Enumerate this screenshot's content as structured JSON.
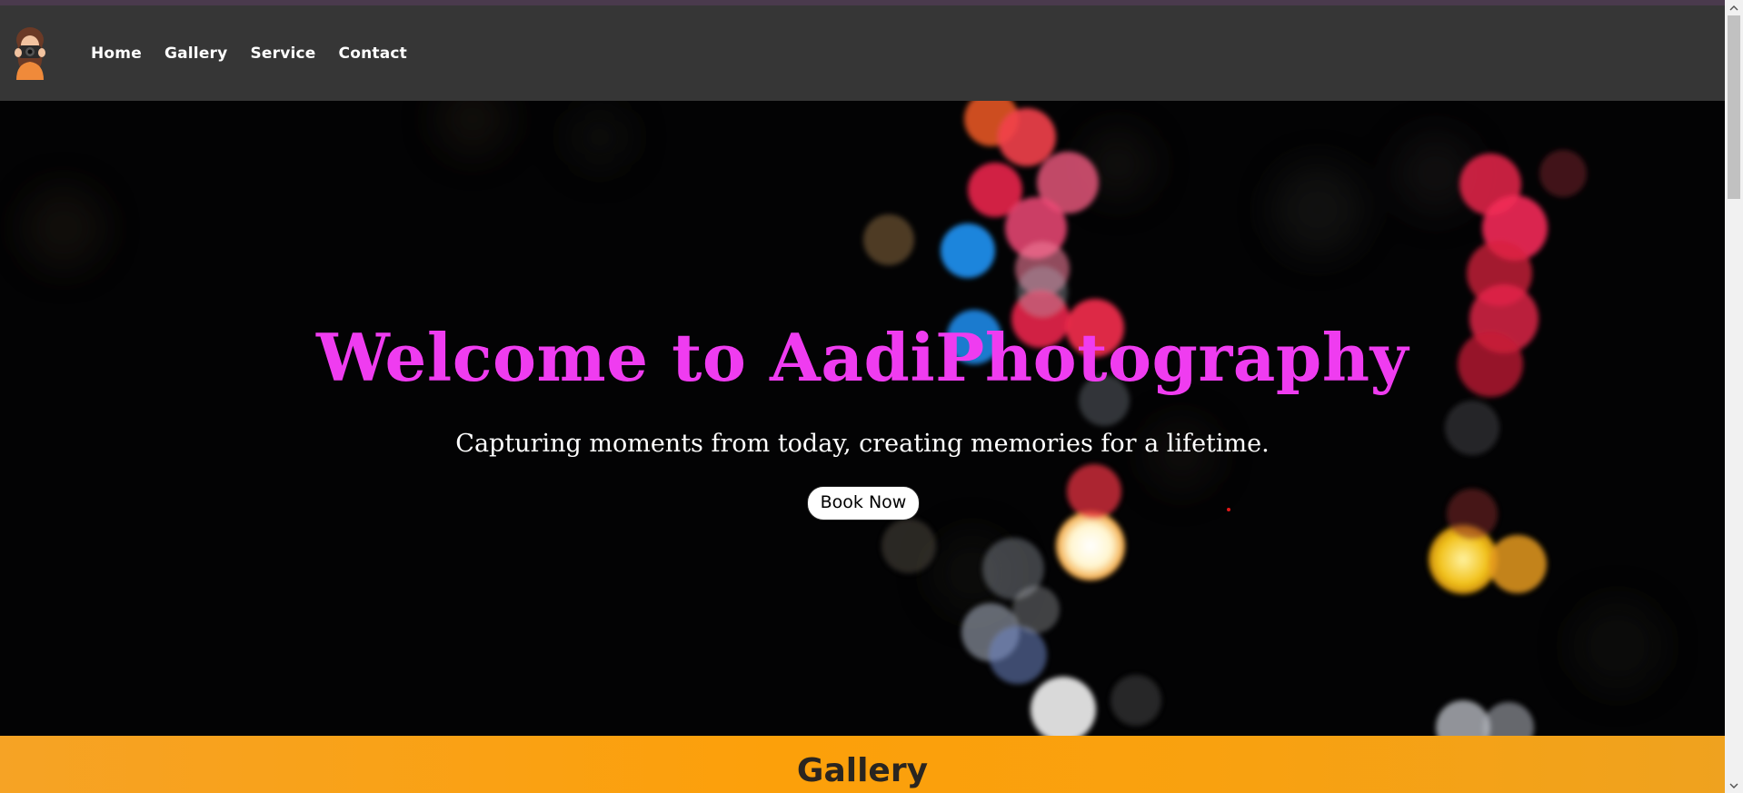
{
  "nav": {
    "logo_icon": "photographer-avatar-icon",
    "links": [
      {
        "label": "Home"
      },
      {
        "label": "Gallery"
      },
      {
        "label": "Service"
      },
      {
        "label": "Contact"
      }
    ]
  },
  "hero": {
    "title": "Welcome to AadiPhotography",
    "subtitle": "Capturing moments from today, creating memories for a lifetime.",
    "cta_label": "Book Now",
    "background_icon": "bokeh-lights-background"
  },
  "gallery": {
    "title": "Gallery"
  },
  "colors": {
    "navbar": "#363636",
    "title": "#ef3cf0",
    "gallery_band": "#fca00a",
    "hero_bg": "#030304"
  }
}
